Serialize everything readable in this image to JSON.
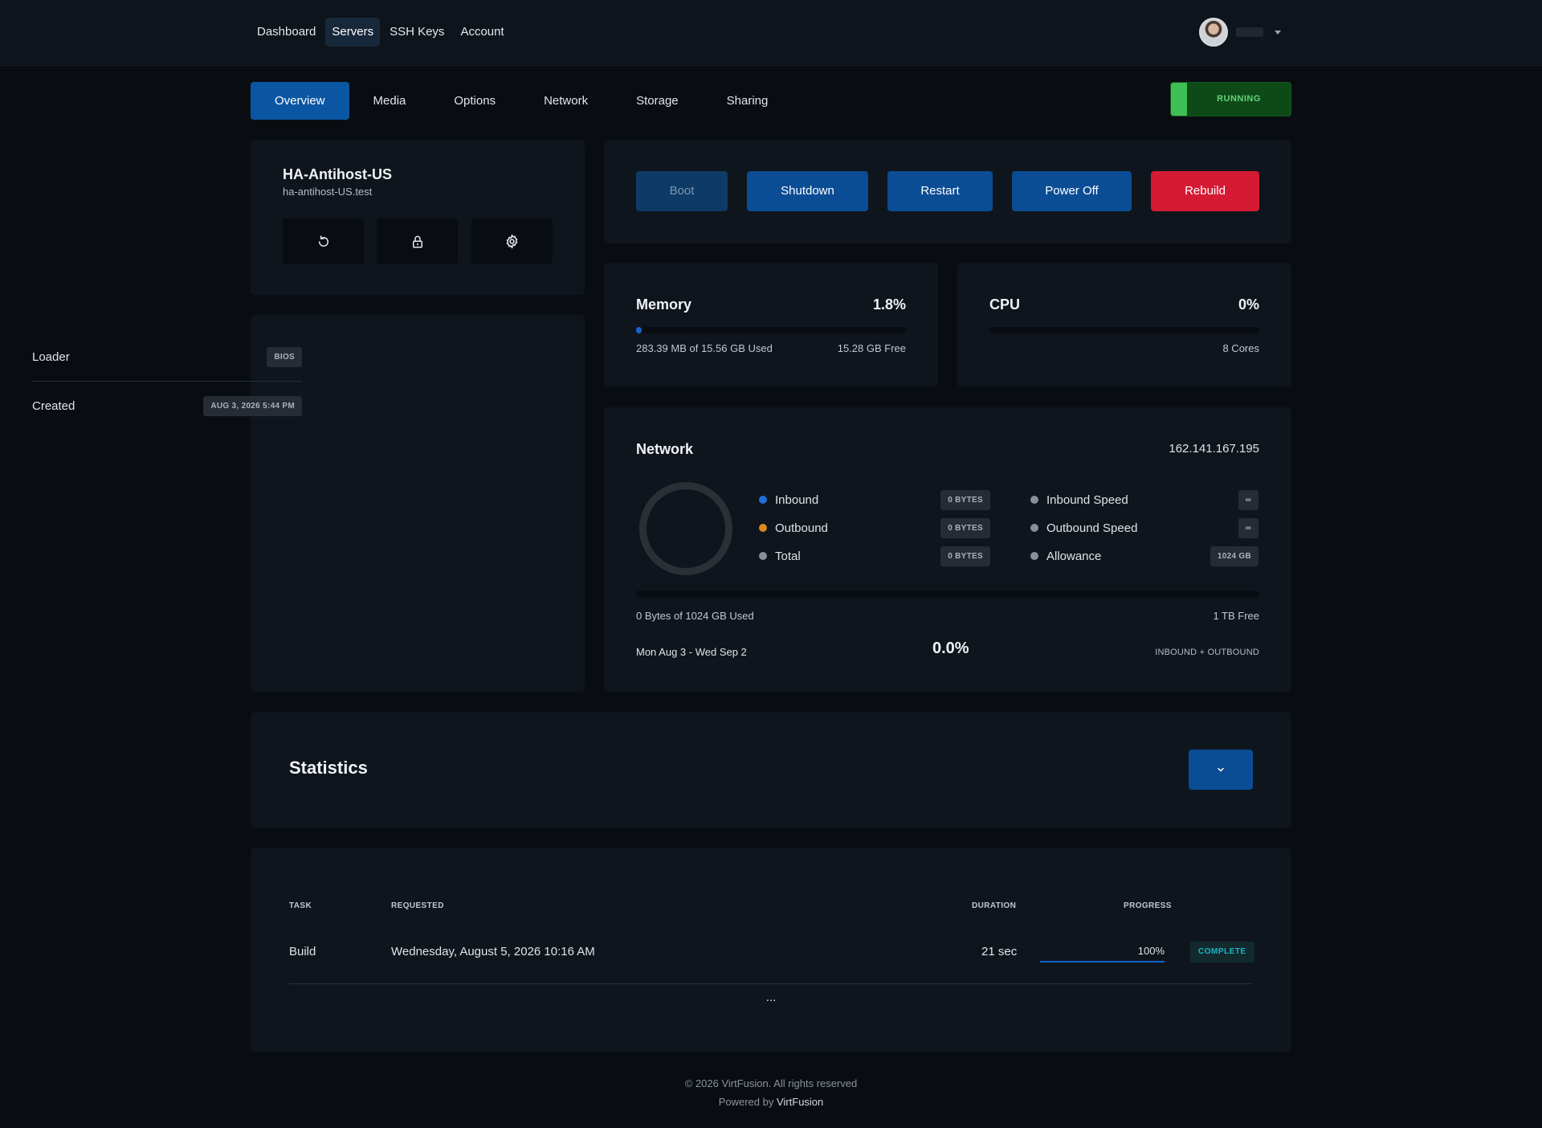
{
  "nav": {
    "items": [
      {
        "label": "Dashboard"
      },
      {
        "label": "Servers"
      },
      {
        "label": "SSH Keys"
      },
      {
        "label": "Account"
      }
    ],
    "active": "Servers"
  },
  "user": {
    "avatar_icon": "user-avatar"
  },
  "tabs": [
    {
      "label": "Overview"
    },
    {
      "label": "Media"
    },
    {
      "label": "Options"
    },
    {
      "label": "Network"
    },
    {
      "label": "Storage"
    },
    {
      "label": "Sharing"
    }
  ],
  "status": {
    "label": "RUNNING",
    "color": "#3fbf55"
  },
  "server": {
    "name": "HA-Antihost-US",
    "hostname": "ha-antihost-US.test",
    "icon_buttons": [
      "restart-icon",
      "lock-icon",
      "gear-icon"
    ]
  },
  "info": {
    "loader_label": "Loader",
    "loader_value": "BIOS",
    "created_label": "Created",
    "created_value": "AUG 3, 2026 5:44 PM"
  },
  "actions": {
    "boot": "Boot",
    "shutdown": "Shutdown",
    "restart": "Restart",
    "power_off": "Power Off",
    "rebuild": "Rebuild"
  },
  "memory": {
    "title": "Memory",
    "percent": "1.8%",
    "fraction": 0.018,
    "used": "283.39 MB of 15.56 GB Used",
    "free": "15.28 GB Free"
  },
  "cpu": {
    "title": "CPU",
    "percent": "0%",
    "fraction": 0,
    "cores": "8 Cores"
  },
  "network": {
    "title": "Network",
    "ip": "162.141.167.195",
    "legend": {
      "inbound_label": "Inbound",
      "inbound_value": "0 BYTES",
      "inbound_color": "#1f6fd6",
      "outbound_label": "Outbound",
      "outbound_value": "0 BYTES",
      "outbound_color": "#d98a1c",
      "total_label": "Total",
      "total_value": "0 BYTES",
      "inbound_speed_label": "Inbound Speed",
      "inbound_speed_value": "∞",
      "outbound_speed_label": "Outbound Speed",
      "outbound_speed_value": "∞",
      "allowance_label": "Allowance",
      "allowance_value": "1024 GB"
    },
    "used_text": "0 Bytes of 1024 GB Used",
    "free_text": "1 TB Free",
    "period": "Mon Aug 3 - Wed Sep 2",
    "usage_percent": "0.0%",
    "usage_scope": "INBOUND + OUTBOUND"
  },
  "statistics": {
    "title": "Statistics"
  },
  "tasks": {
    "headers": {
      "task": "TASK",
      "requested": "REQUESTED",
      "duration": "DURATION",
      "progress": "PROGRESS"
    },
    "rows": [
      {
        "task": "Build",
        "requested": "Wednesday, August 5, 2026 10:16 AM",
        "duration": "21 sec",
        "progress": "100%",
        "progress_fraction": 1.0,
        "status": "COMPLETE"
      }
    ],
    "more": "..."
  },
  "footer": {
    "copyright": "© 2026 VirtFusion. All rights reserved",
    "powered_prefix": "Powered by",
    "powered_brand": "VirtFusion"
  }
}
